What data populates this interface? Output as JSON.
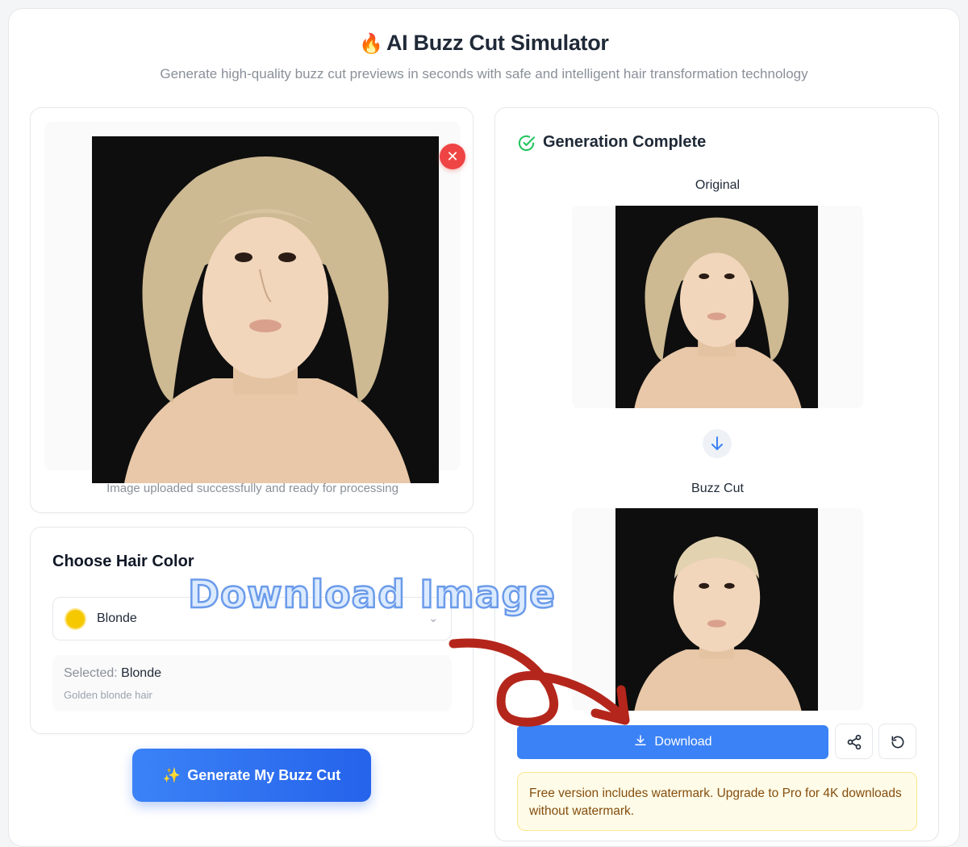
{
  "header": {
    "title": "AI Buzz Cut Simulator",
    "flame_icon": "🔥",
    "subtitle": "Generate high-quality buzz cut previews in seconds with safe and intelligent hair transformation technology"
  },
  "upload": {
    "remove_icon": "close-icon",
    "status_text": "Image uploaded successfully and ready for processing"
  },
  "hair_color": {
    "heading": "Choose Hair Color",
    "selected_option": "Blonde",
    "swatch_color": "#f5c800",
    "selected_prefix": "Selected:",
    "selected_value": "Blonde",
    "description": "Golden blonde hair"
  },
  "generate_button": {
    "icon": "✨",
    "label": "Generate My Buzz Cut"
  },
  "result": {
    "status": "Generation Complete",
    "original_label": "Original",
    "buzz_label": "Buzz Cut",
    "download_label": "Download",
    "notice": "Free version includes watermark. Upgrade to Pro for 4K downloads without watermark."
  },
  "annotation": {
    "text": "Download Image",
    "arrow_color": "#b4261b"
  },
  "colors": {
    "accent": "#3b82f6",
    "success": "#22c55e",
    "danger": "#ef4444"
  }
}
